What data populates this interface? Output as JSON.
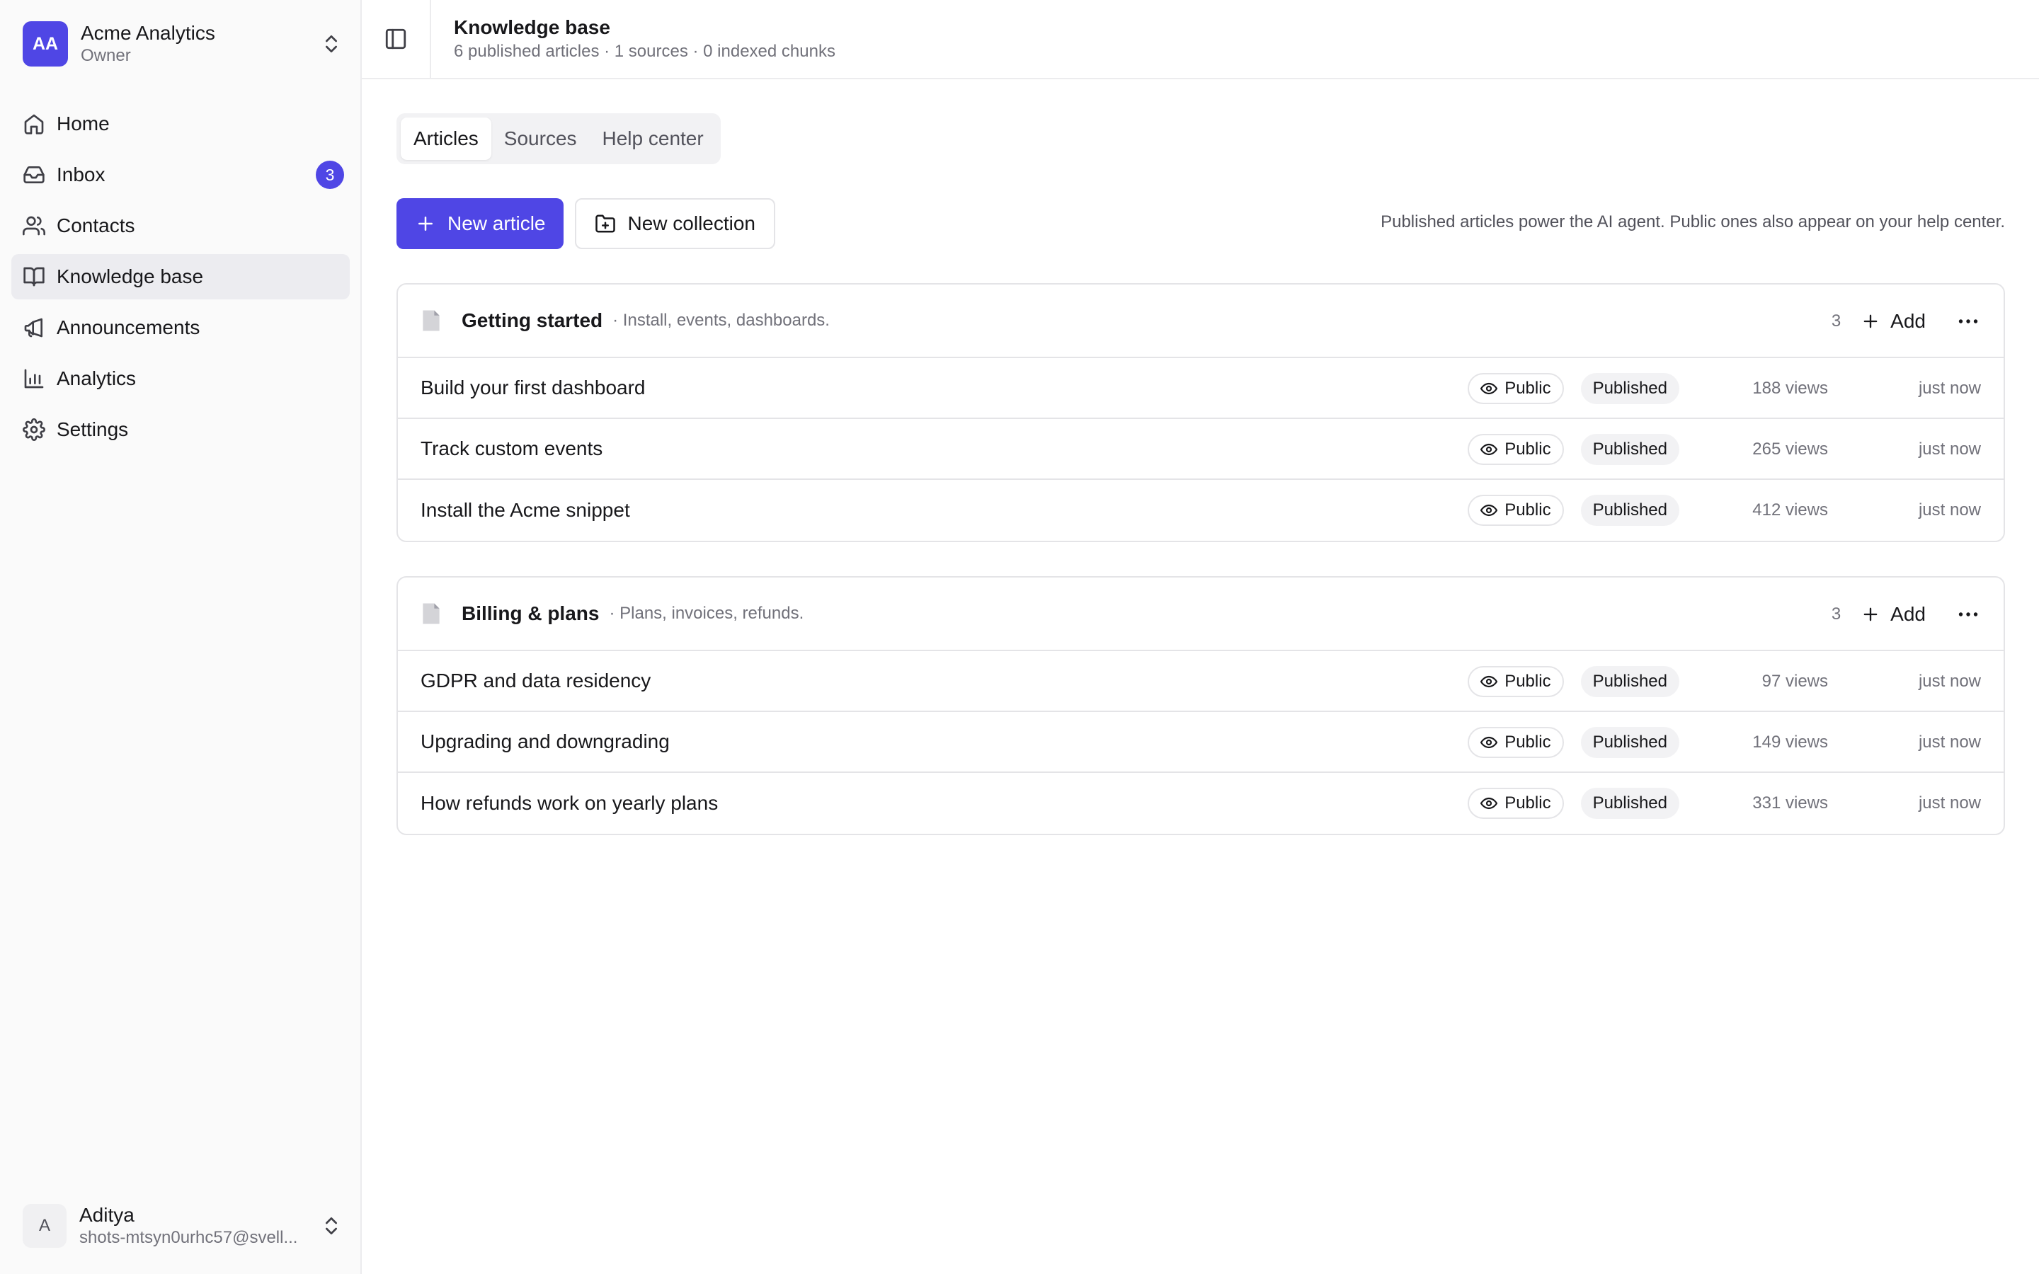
{
  "org": {
    "initials": "AA",
    "name": "Acme Analytics",
    "role": "Owner"
  },
  "nav": {
    "items": [
      {
        "label": "Home",
        "icon": "home-icon"
      },
      {
        "label": "Inbox",
        "icon": "inbox-icon",
        "badge": "3"
      },
      {
        "label": "Contacts",
        "icon": "users-icon"
      },
      {
        "label": "Knowledge base",
        "icon": "book-icon",
        "active": true
      },
      {
        "label": "Announcements",
        "icon": "megaphone-icon"
      },
      {
        "label": "Analytics",
        "icon": "bar-chart-icon"
      },
      {
        "label": "Settings",
        "icon": "gear-icon"
      }
    ]
  },
  "user": {
    "initial": "A",
    "name": "Aditya",
    "email": "shots-mtsyn0urhc57@svell..."
  },
  "header": {
    "title": "Knowledge base",
    "subtitle": "6 published articles · 1 sources · 0 indexed chunks"
  },
  "tabs": [
    {
      "label": "Articles",
      "active": true
    },
    {
      "label": "Sources"
    },
    {
      "label": "Help center"
    }
  ],
  "actions": {
    "new_article": "New article",
    "new_collection": "New collection",
    "helper": "Published articles power the AI agent. Public ones also appear on your help center."
  },
  "collections": [
    {
      "name": "Getting started",
      "description": "· Install, events, dashboards.",
      "count": "3",
      "add_label": "Add",
      "articles": [
        {
          "title": "Build your first dashboard",
          "visibility": "Public",
          "status": "Published",
          "views": "188 views",
          "updated": "just now"
        },
        {
          "title": "Track custom events",
          "visibility": "Public",
          "status": "Published",
          "views": "265 views",
          "updated": "just now"
        },
        {
          "title": "Install the Acme snippet",
          "visibility": "Public",
          "status": "Published",
          "views": "412 views",
          "updated": "just now"
        }
      ]
    },
    {
      "name": "Billing & plans",
      "description": "· Plans, invoices, refunds.",
      "count": "3",
      "add_label": "Add",
      "articles": [
        {
          "title": "GDPR and data residency",
          "visibility": "Public",
          "status": "Published",
          "views": "97 views",
          "updated": "just now"
        },
        {
          "title": "Upgrading and downgrading",
          "visibility": "Public",
          "status": "Published",
          "views": "149 views",
          "updated": "just now"
        },
        {
          "title": "How refunds work on yearly plans",
          "visibility": "Public",
          "status": "Published",
          "views": "331 views",
          "updated": "just now"
        }
      ]
    }
  ],
  "colors": {
    "accent": "#4f46e5",
    "sidebar_bg": "#fafafa",
    "border": "#e4e4e7",
    "muted_text": "#71717a"
  }
}
